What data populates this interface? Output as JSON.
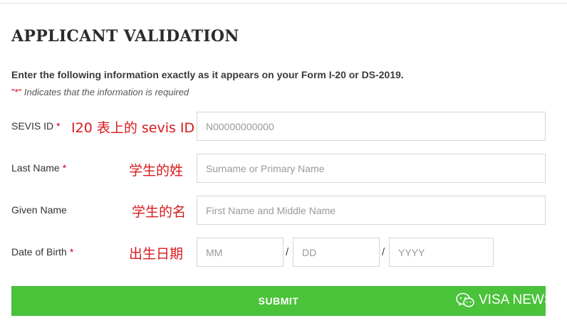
{
  "form": {
    "title": "APPLICANT VALIDATION",
    "instructions": "Enter the following information exactly as it appears on your Form I-20 or DS-2019.",
    "required_note_star": "\"*\"",
    "required_note_text": " Indicates that the information is required",
    "required_marker": "*",
    "fields": {
      "sevis_id": {
        "label": "SEVIS ID",
        "placeholder": "N00000000000",
        "annotation": "I20 表上的 sevis ID"
      },
      "last_name": {
        "label": "Last Name",
        "placeholder": "Surname or Primary Name",
        "annotation": "学生的姓"
      },
      "given_name": {
        "label": "Given Name",
        "placeholder": "First Name and Middle Name",
        "annotation": "学生的名"
      },
      "date_of_birth": {
        "label": "Date of Birth",
        "annotation": "出生日期",
        "month_placeholder": "MM",
        "day_placeholder": "DD",
        "year_placeholder": "YYYY",
        "separator": "/"
      }
    },
    "submit_label": "SUBMIT"
  },
  "watermark": {
    "text": "VISA NEWS",
    "icon": "wechat-icon"
  },
  "colors": {
    "submit_bg": "#4ac23a",
    "annotation": "#d8191c",
    "required": "#d0021b"
  }
}
